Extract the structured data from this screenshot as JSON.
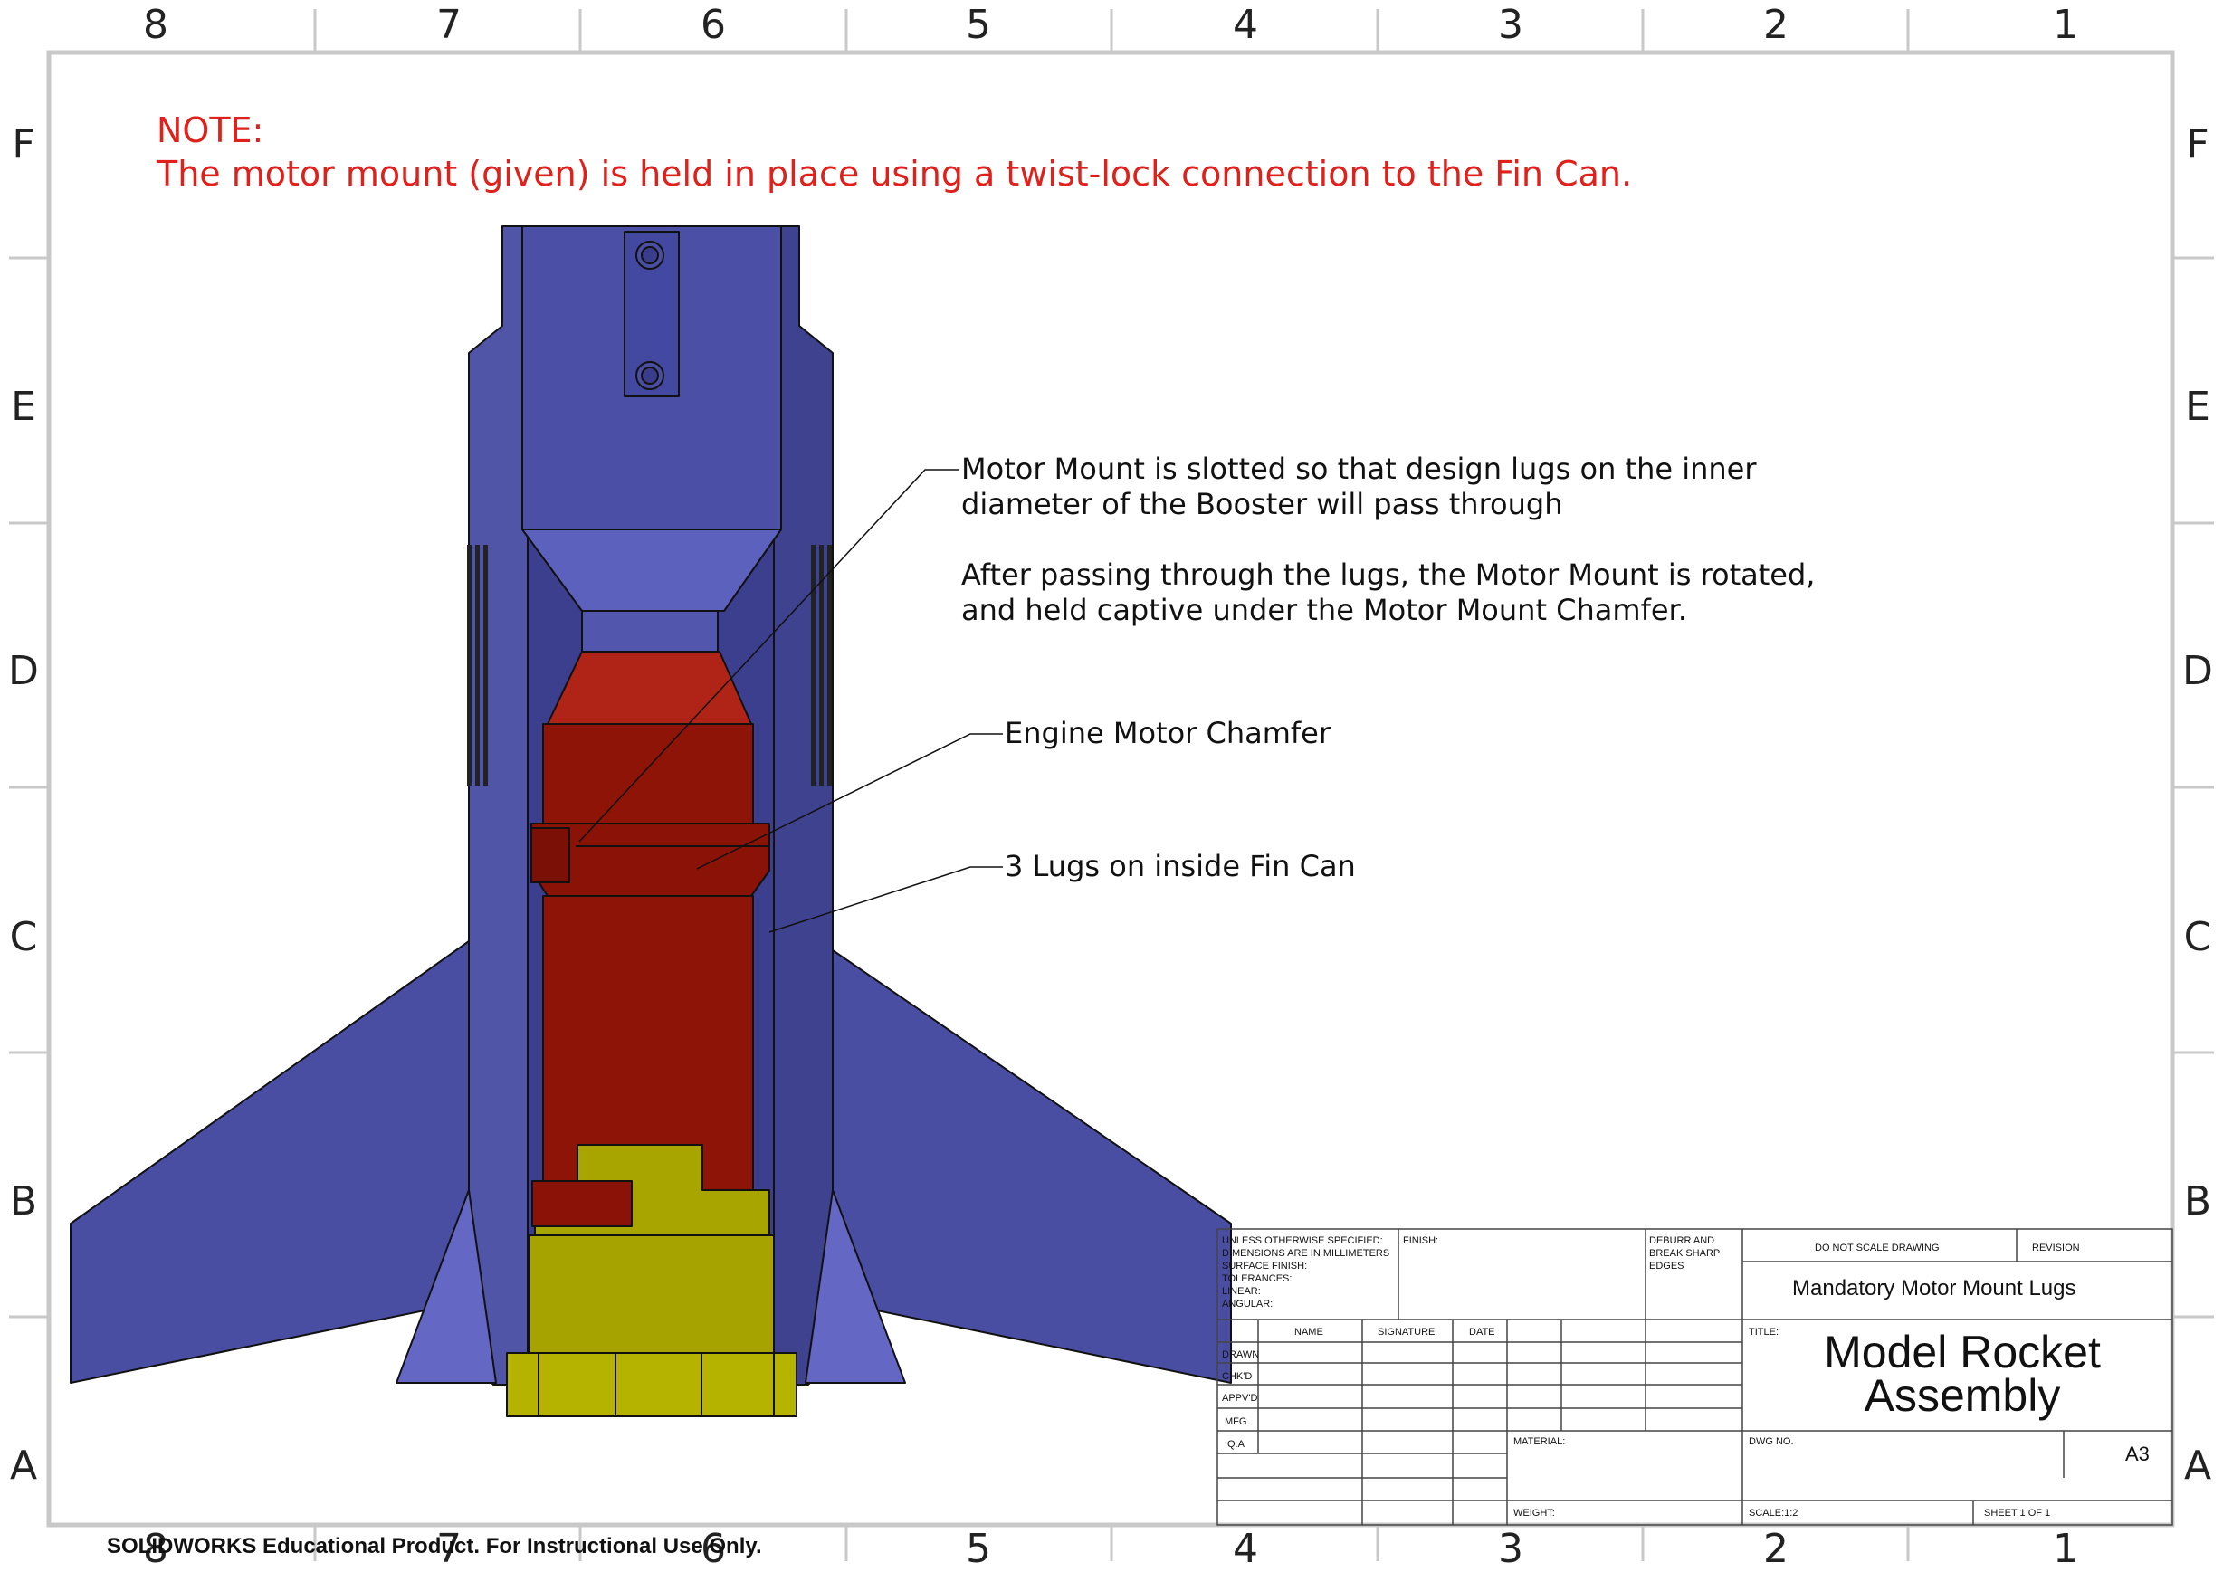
{
  "zones": {
    "columns": [
      "8",
      "7",
      "6",
      "5",
      "4",
      "3",
      "2",
      "1"
    ],
    "rows": [
      "F",
      "E",
      "D",
      "C",
      "B",
      "A"
    ]
  },
  "note": {
    "heading": "NOTE:",
    "text": "The motor mount (given) is held in place using a twist-lock connection to the Fin Can."
  },
  "callouts": {
    "motor_mount_1": "Motor Mount is slotted so that design lugs on the inner",
    "motor_mount_2": "diameter of the Booster will pass through",
    "motor_mount_3": "After passing through the lugs, the Motor Mount is rotated,",
    "motor_mount_4": "and held captive under the Motor Mount Chamfer.",
    "chamfer": "Engine Motor Chamfer",
    "lugs": "3 Lugs on inside Fin Can"
  },
  "title_block": {
    "unless_lines": [
      "UNLESS OTHERWISE SPECIFIED:",
      "DIMENSIONS ARE IN MILLIMETERS",
      "SURFACE FINISH:",
      "TOLERANCES:",
      "LINEAR:",
      "ANGULAR:"
    ],
    "finish": "FINISH:",
    "deburr_lines": [
      "DEBURR AND",
      "BREAK SHARP",
      "EDGES"
    ],
    "do_not_scale": "DO NOT SCALE DRAWING",
    "revision": "REVISION",
    "subtitle": "Mandatory Motor Mount Lugs",
    "col_name": "NAME",
    "col_signature": "SIGNATURE",
    "col_date": "DATE",
    "rows": [
      "DRAWN",
      "CHK'D",
      "APPV'D",
      "MFG",
      "Q.A"
    ],
    "title_label": "TITLE:",
    "title_line1": "Model Rocket",
    "title_line2": "Assembly",
    "material": "MATERIAL:",
    "dwg_no": "DWG NO.",
    "size": "A3",
    "weight": "WEIGHT:",
    "scale": "SCALE:1:2",
    "sheet": "SHEET 1 OF 1"
  },
  "footer": "SOLIDWORKS Educational Product. For Instructional Use Only.",
  "colors": {
    "body_blue": "#4b4fa3",
    "blue_dark": "#3a3d8c",
    "red": "#8e1408",
    "yellow": "#a8a400",
    "note_red": "#e0201a"
  }
}
